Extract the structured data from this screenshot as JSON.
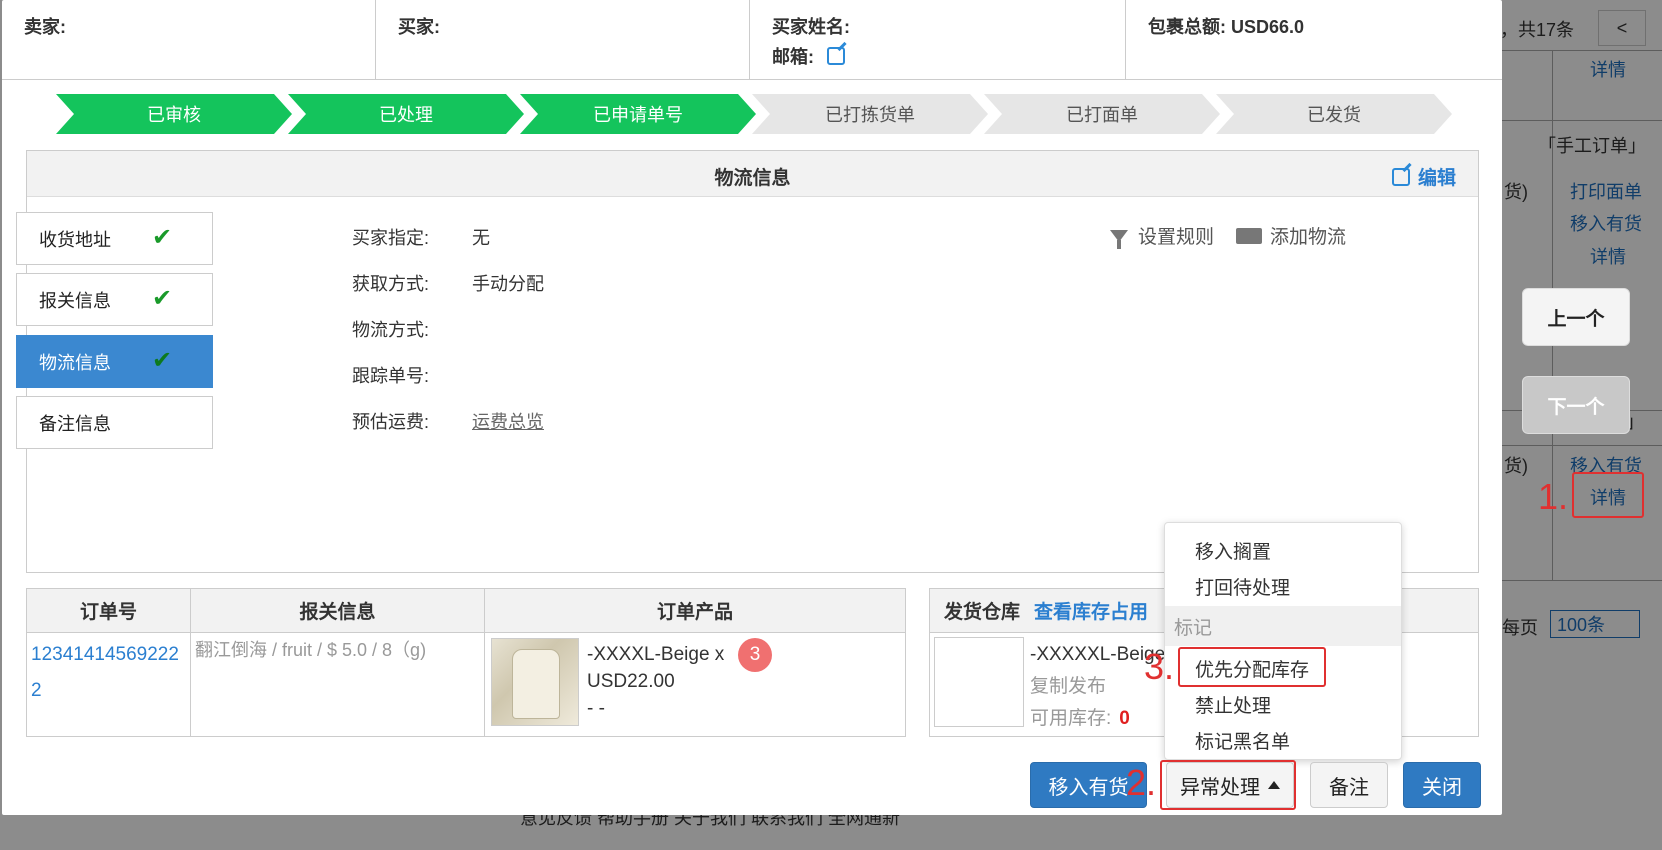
{
  "background": {
    "count_text": "，共17条",
    "prev_page": "<",
    "links": {
      "detail_1": "详情",
      "manual_order": "「手工订单」",
      "text_cut_1": "货)",
      "print_label": "打印面单",
      "move_instock_1": "移入有货",
      "detail_2": "详情",
      "bracket_cut": "」",
      "text_cut_2": "货)",
      "move_instock_2": "移入有货",
      "detail_3": "详情",
      "per_page": "每页"
    },
    "per_page_value": "100条",
    "footer_text": "意见反馈 帮助手册 关于我们 联系我们 全网通新",
    "nav": {
      "prev": "上一个",
      "next": "下一个"
    },
    "annotations": {
      "one": "1.",
      "two": "2.",
      "three": "3."
    }
  },
  "modal": {
    "info": {
      "seller": "卖家:",
      "buyer": "买家:",
      "buyer_name": "买家姓名:",
      "email": "邮箱:",
      "total": "包裹总额: USD66.0"
    },
    "steps": [
      {
        "label": "已审核",
        "status": "done"
      },
      {
        "label": "已处理",
        "status": "done"
      },
      {
        "label": "已申请单号",
        "status": "done"
      },
      {
        "label": "已打拣货单",
        "status": "todo"
      },
      {
        "label": "已打面单",
        "status": "todo"
      },
      {
        "label": "已发货",
        "status": "todo"
      }
    ],
    "panel": {
      "title": "物流信息",
      "edit": "编辑"
    },
    "side_tabs": [
      {
        "label": "收货地址",
        "checked": true
      },
      {
        "label": "报关信息",
        "checked": true
      },
      {
        "label": "物流信息",
        "checked": true,
        "active": true
      },
      {
        "label": "备注信息",
        "checked": false
      }
    ],
    "fields": {
      "buyer_specified_label": "买家指定:",
      "buyer_specified_value": "无",
      "acquire_label": "获取方式:",
      "acquire_value": "手动分配",
      "method_label": "物流方式:",
      "tracking_label": "跟踪单号:",
      "est_fee_label": "预估运费:",
      "est_fee_value": "运费总览"
    },
    "actions": {
      "set_rule": "设置规则",
      "add_logistics": "添加物流"
    },
    "order_table": {
      "headers": [
        "订单号",
        "报关信息",
        "订单产品"
      ],
      "order_no": "123414145692222",
      "customs": "翻江倒海 / fruit / $ 5.0 / 8（g)",
      "product_name": "-XXXXL-Beige x",
      "product_price": "USD22.00",
      "product_extra": "- -",
      "badge": "3"
    },
    "warehouse": {
      "title": "发货仓库",
      "stock_link": "查看库存占用",
      "product": "-XXXXXL-Beige",
      "copy_publish": "复制发布",
      "available_label": "可用库存:",
      "available_value": "0"
    },
    "dropdown": {
      "move_hold": "移入搁置",
      "back_pending": "打回待处理",
      "section_mark": "标记",
      "priority_stock": "优先分配库存",
      "forbid": "禁止处理",
      "blacklist": "标记黑名单"
    },
    "buttons": {
      "move_instock": "移入有货",
      "exception": "异常处理",
      "note": "备注",
      "close": "关闭"
    }
  }
}
